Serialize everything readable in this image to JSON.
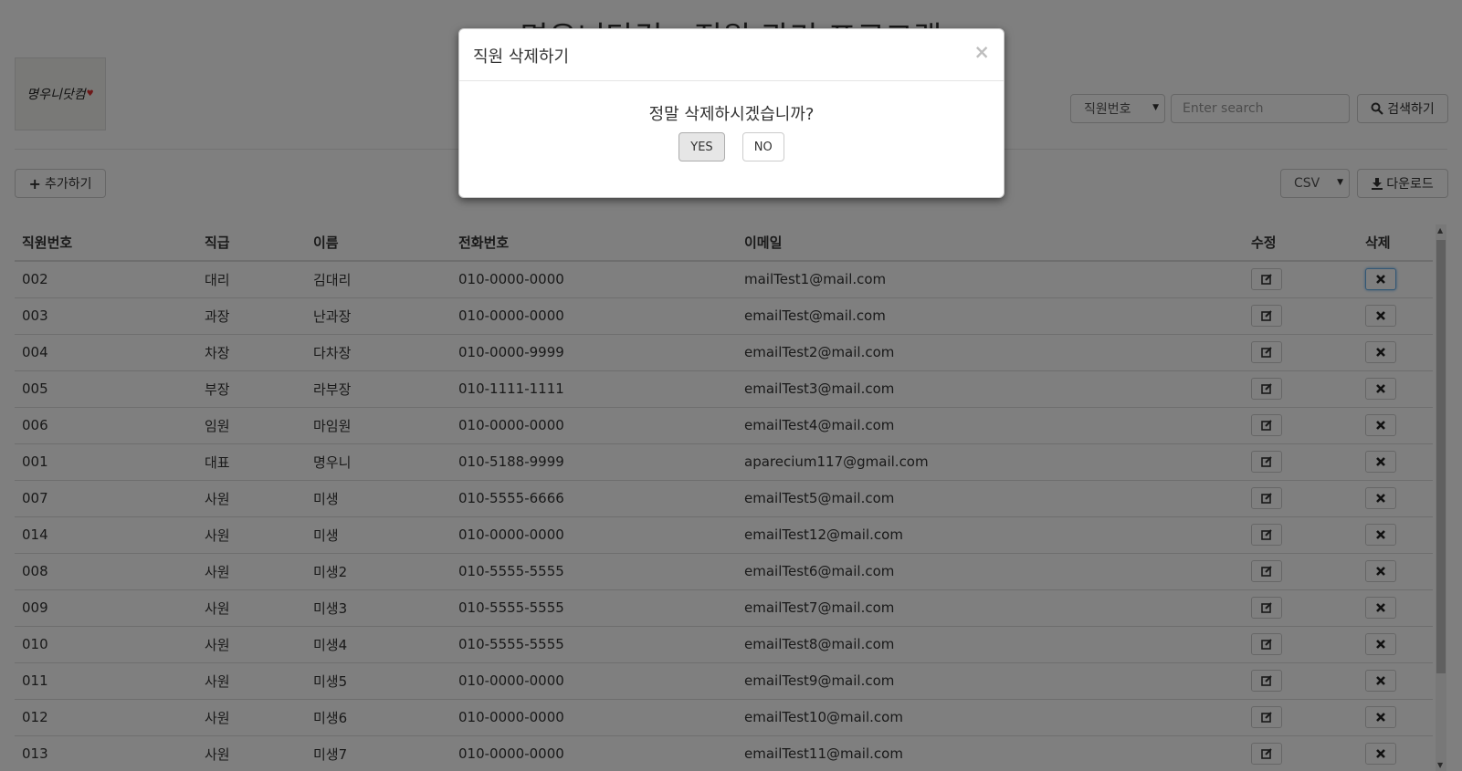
{
  "page": {
    "title": "명우니닷컴 - 직원 관리 프로그램"
  },
  "logo": {
    "text": "명우니닷컴"
  },
  "search": {
    "field_selected": "직원번호",
    "placeholder": "Enter search",
    "button_label": "검색하기"
  },
  "toolbar": {
    "add_label": "추가하기",
    "format_selected": "CSV",
    "download_label": "다운로드"
  },
  "table": {
    "headers": [
      "직원번호",
      "직급",
      "이름",
      "전화번호",
      "이메일",
      "수정",
      "삭제"
    ],
    "rows": [
      [
        "002",
        "대리",
        "김대리",
        "010-0000-0000",
        "mailTest1@mail.com"
      ],
      [
        "003",
        "과장",
        "난과장",
        "010-0000-0000",
        "emailTest@mail.com"
      ],
      [
        "004",
        "차장",
        "다차장",
        "010-0000-9999",
        "emailTest2@mail.com"
      ],
      [
        "005",
        "부장",
        "라부장",
        "010-1111-1111",
        "emailTest3@mail.com"
      ],
      [
        "006",
        "임원",
        "마임원",
        "010-0000-0000",
        "emailTest4@mail.com"
      ],
      [
        "001",
        "대표",
        "명우니",
        "010-5188-9999",
        "aparecium117@gmail.com"
      ],
      [
        "007",
        "사원",
        "미생",
        "010-5555-6666",
        "emailTest5@mail.com"
      ],
      [
        "014",
        "사원",
        "미생",
        "010-0000-0000",
        "emailTest12@mail.com"
      ],
      [
        "008",
        "사원",
        "미생2",
        "010-5555-5555",
        "emailTest6@mail.com"
      ],
      [
        "009",
        "사원",
        "미생3",
        "010-5555-5555",
        "emailTest7@mail.com"
      ],
      [
        "010",
        "사원",
        "미생4",
        "010-5555-5555",
        "emailTest8@mail.com"
      ],
      [
        "011",
        "사원",
        "미생5",
        "010-0000-0000",
        "emailTest9@mail.com"
      ],
      [
        "012",
        "사원",
        "미생6",
        "010-0000-0000",
        "emailTest10@mail.com"
      ],
      [
        "013",
        "사원",
        "미생7",
        "010-0000-0000",
        "emailTest11@mail.com"
      ]
    ]
  },
  "modal": {
    "title": "직원 삭제하기",
    "close": "×",
    "question": "정말 삭제하시겠습니까?",
    "yes_label": "YES",
    "no_label": "NO"
  },
  "icons": {
    "edit": "edit-icon",
    "delete": "remove-icon",
    "plus": "plus-icon",
    "search": "search-icon",
    "download": "download-icon"
  }
}
